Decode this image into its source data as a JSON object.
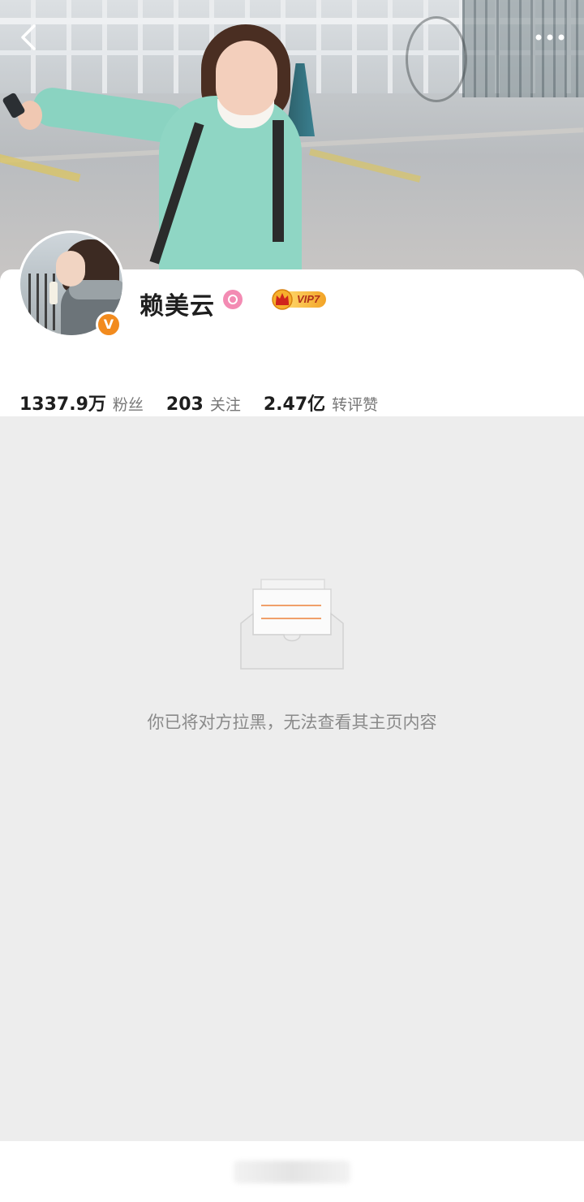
{
  "cover": {
    "back_icon": "chevron-left-icon",
    "more_icon": "more-dots-icon"
  },
  "profile": {
    "name": "赖美云",
    "verified_badge": "V",
    "verified_color": "#f28b1e",
    "super_topic_icon": "search-circle-icon",
    "vip_label": "VIP7",
    "vip_colors": [
      "#ffd86b",
      "#f2a326"
    ]
  },
  "stats": [
    {
      "value": "1337.9万",
      "label": "粉丝"
    },
    {
      "value": "203",
      "label": "关注"
    },
    {
      "value": "2.47亿",
      "label": "转评赞"
    }
  ],
  "empty_state": {
    "icon": "empty-inbox-icon",
    "message": "你已将对方拉黑，无法查看其主页内容"
  },
  "theme": {
    "background": "#ededed",
    "card": "#ffffff",
    "accent": "#f28b1e"
  }
}
